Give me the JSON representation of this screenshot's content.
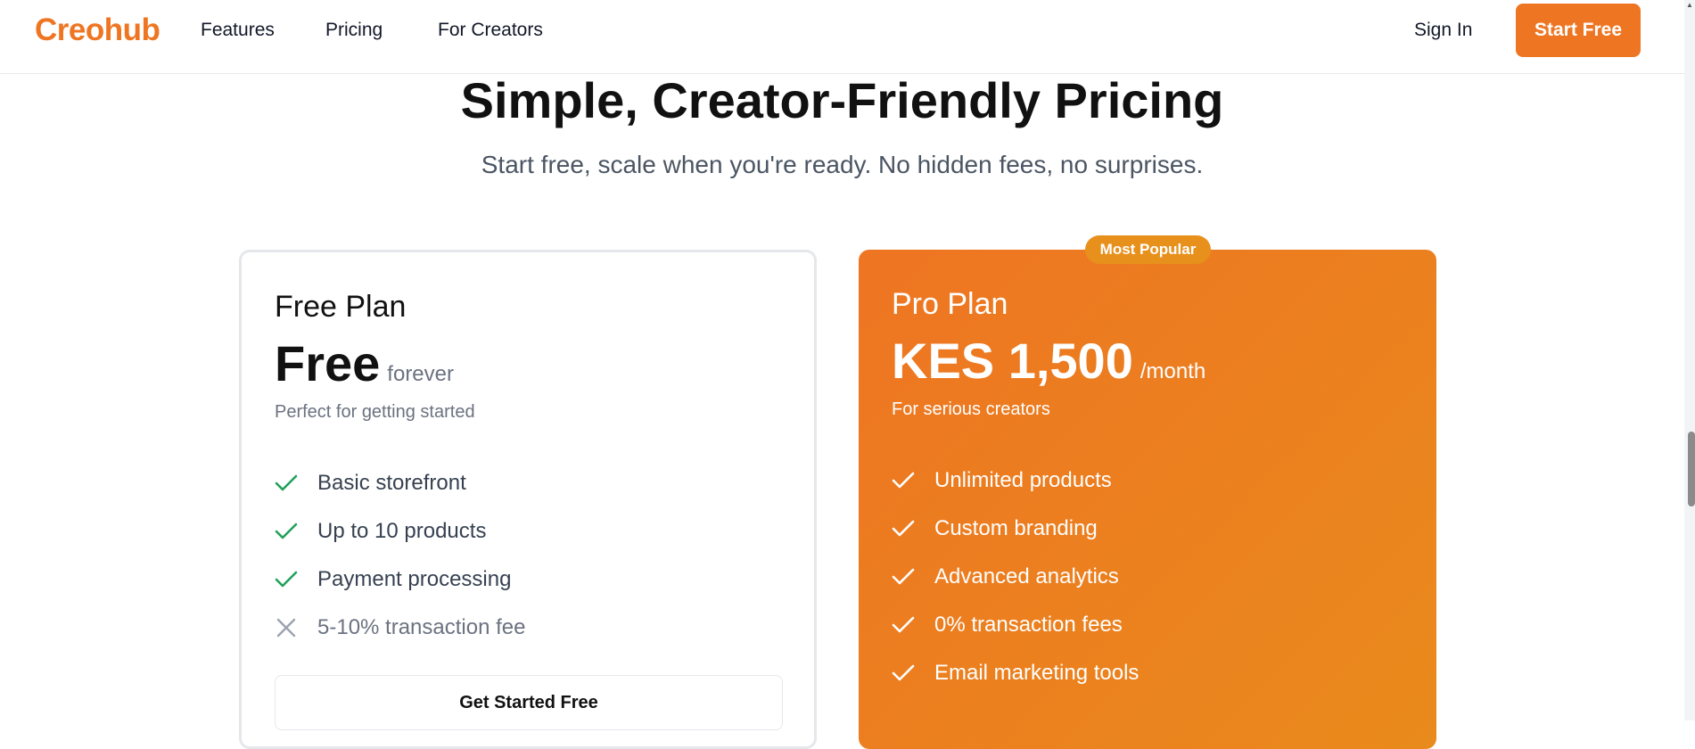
{
  "nav": {
    "logo": "Creohub",
    "links": [
      "Features",
      "Pricing",
      "For Creators"
    ],
    "sign_in": "Sign In",
    "start_free": "Start Free",
    "accent_color": "#ee7623"
  },
  "header": {
    "title": "Simple, Creator-Friendly Pricing",
    "subtitle": "Start free, scale when you're ready. No hidden fees, no surprises."
  },
  "plans": {
    "free": {
      "name": "Free Plan",
      "price": "Free",
      "period": "forever",
      "description": "Perfect for getting started",
      "features": [
        {
          "label": "Basic storefront",
          "icon": "check-icon",
          "included": true
        },
        {
          "label": "Up to 10 products",
          "icon": "check-icon",
          "included": true
        },
        {
          "label": "Payment processing",
          "icon": "check-icon",
          "included": true
        },
        {
          "label": "5-10% transaction fee",
          "icon": "x-icon",
          "included": false
        }
      ],
      "cta": "Get Started Free",
      "check_color": "#22a05a",
      "x_color": "#9ca3af"
    },
    "pro": {
      "badge": "Most Popular",
      "name": "Pro Plan",
      "price": "KES 1,500",
      "period": "/month",
      "description": "For serious creators",
      "features": [
        {
          "label": "Unlimited products",
          "icon": "check-icon",
          "included": true
        },
        {
          "label": "Custom branding",
          "icon": "check-icon",
          "included": true
        },
        {
          "label": "Advanced analytics",
          "icon": "check-icon",
          "included": true
        },
        {
          "label": "0% transaction fees",
          "icon": "check-icon",
          "included": true
        },
        {
          "label": "Email marketing tools",
          "icon": "check-icon",
          "included": true
        }
      ],
      "gradient_start": "#ee7522",
      "gradient_end": "#e98a1c",
      "badge_color": "#e8901c"
    }
  }
}
